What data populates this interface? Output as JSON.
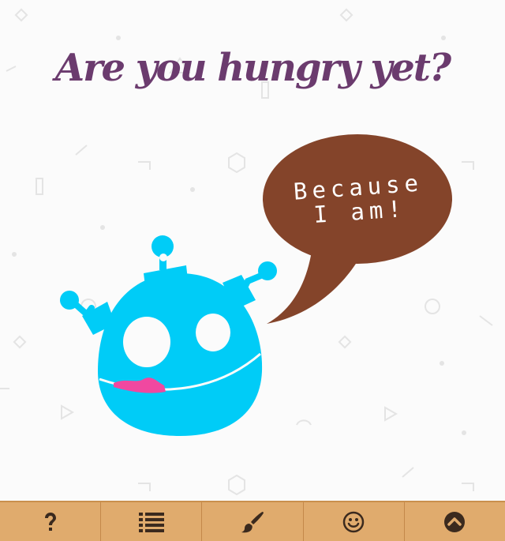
{
  "title": "Are you hungry yet?",
  "speech_bubble": {
    "line1": "Because",
    "line2": "I am!"
  },
  "colors": {
    "title": "#6b3b6e",
    "monster": "#00ccf7",
    "bubble": "#84442a",
    "tongue": "#f048a0",
    "toolbar": "#e0ab6d",
    "toolbar_icon": "#3b2a1e"
  },
  "toolbar": {
    "buttons": [
      {
        "icon": "help-icon"
      },
      {
        "icon": "list-icon"
      },
      {
        "icon": "brush-icon"
      },
      {
        "icon": "smiley-icon"
      },
      {
        "icon": "chevron-up-circle-icon"
      }
    ]
  }
}
